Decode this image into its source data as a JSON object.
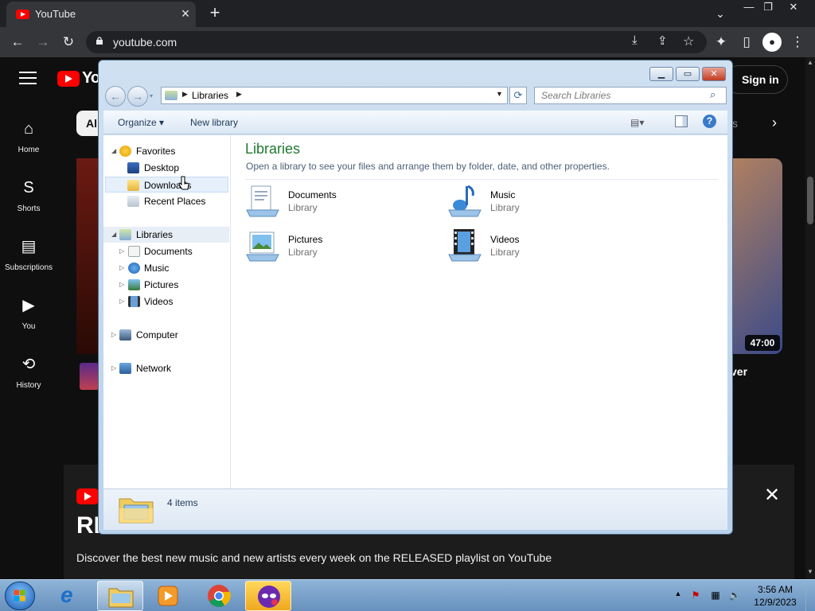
{
  "browser": {
    "tab_title": "YouTube",
    "tab_close": "×",
    "new_tab": "+",
    "url": "youtube.com",
    "window_controls": {
      "min": "—",
      "restore": "❐",
      "close": "✕"
    },
    "tab_menu": "⌄"
  },
  "youtube": {
    "logo_text": "Yo",
    "sign_in": "Sign in",
    "chip_all": "Al",
    "chip_right": "s",
    "nav": [
      {
        "label": "Home",
        "icon": "⌂"
      },
      {
        "label": "Shorts",
        "icon": "S"
      },
      {
        "label": "Subscriptions",
        "icon": "▤"
      },
      {
        "label": "You",
        "icon": "▶"
      },
      {
        "label": "History",
        "icon": "⟲"
      }
    ],
    "video_duration": "47:00",
    "video_title_fragment": "ver",
    "banner_title": "RE",
    "banner_desc": "Discover the best new music and new artists every week on the RELEASED playlist on YouTube",
    "banner_close": "✕"
  },
  "explorer": {
    "address_path": "Libraries",
    "search_placeholder": "Search Libraries",
    "toolbar": {
      "organize": "Organize ▾",
      "new_library": "New library",
      "view_icon": "▤▾",
      "help": "?"
    },
    "nav_pane": {
      "favorites": "Favorites",
      "favorites_items": [
        "Desktop",
        "Downloads",
        "Recent Places"
      ],
      "libraries": "Libraries",
      "library_items": [
        "Documents",
        "Music",
        "Pictures",
        "Videos"
      ],
      "computer": "Computer",
      "network": "Network"
    },
    "main": {
      "title": "Libraries",
      "subtitle": "Open a library to see your files and arrange them by folder, date, and other properties.",
      "libraries": [
        {
          "name": "Documents",
          "type": "Library"
        },
        {
          "name": "Music",
          "type": "Library"
        },
        {
          "name": "Pictures",
          "type": "Library"
        },
        {
          "name": "Videos",
          "type": "Library"
        }
      ]
    },
    "details": {
      "count": "4 items"
    }
  },
  "taskbar": {
    "time": "3:56 AM",
    "date": "12/9/2023"
  }
}
